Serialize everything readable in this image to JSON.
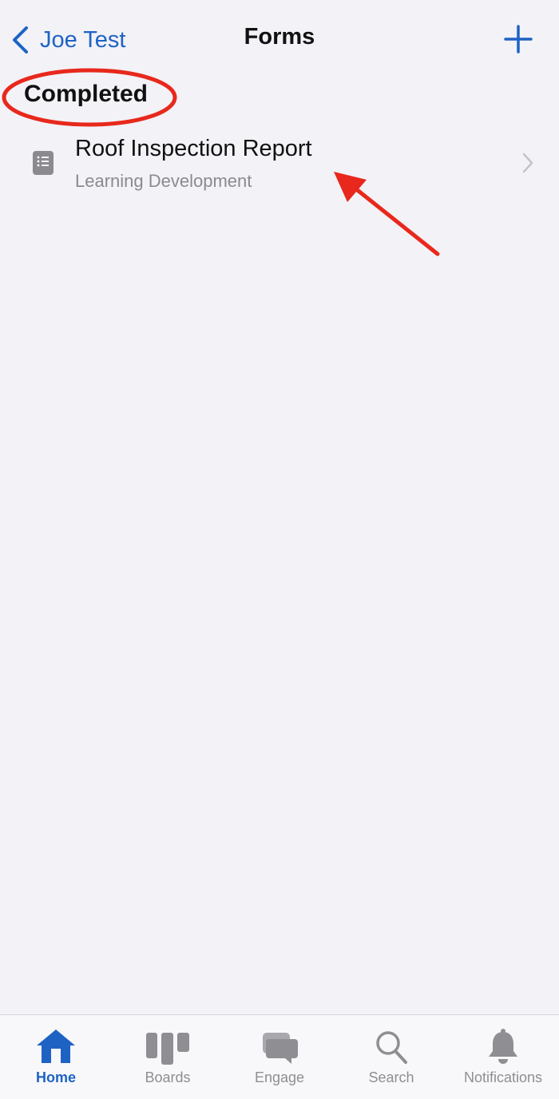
{
  "nav": {
    "back_label": "Joe Test",
    "title": "Forms",
    "add_icon": "plus-icon"
  },
  "section": {
    "header": "Completed"
  },
  "list": {
    "items": [
      {
        "title": "Roof Inspection Report",
        "subtitle": "Learning Development",
        "icon": "document-list-icon"
      }
    ]
  },
  "tabs": [
    {
      "label": "Home",
      "icon": "home-icon",
      "active": true
    },
    {
      "label": "Boards",
      "icon": "boards-icon",
      "active": false
    },
    {
      "label": "Engage",
      "icon": "chat-bubbles-icon",
      "active": false
    },
    {
      "label": "Search",
      "icon": "magnifier-icon",
      "active": false
    },
    {
      "label": "Notifications",
      "icon": "bell-icon",
      "active": false
    }
  ],
  "colors": {
    "accent": "#1e63c4",
    "background": "#f2f2f7",
    "annotation": "#e8281c",
    "inactive_tab": "#8e8e93"
  }
}
